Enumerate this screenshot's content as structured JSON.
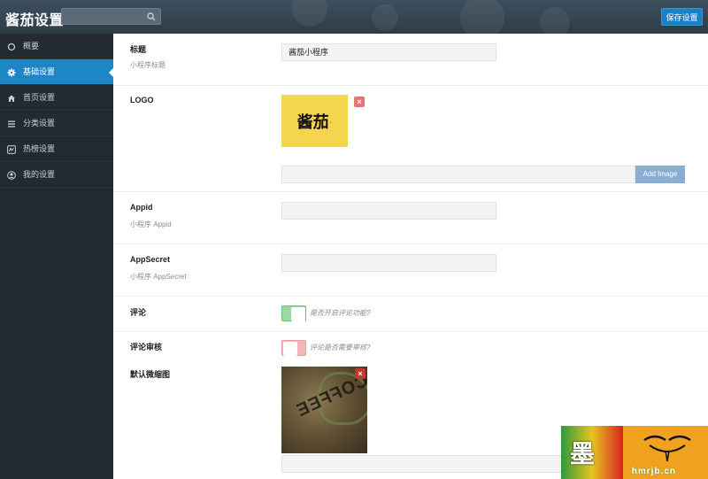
{
  "header": {
    "title": "酱茄设置",
    "search_placeholder": "",
    "save_label": "保存设置"
  },
  "sidebar": {
    "items": [
      {
        "label": "概要",
        "icon": "circle-icon"
      },
      {
        "label": "基础设置",
        "icon": "gear-icon",
        "active": true
      },
      {
        "label": "首页设置",
        "icon": "home-icon"
      },
      {
        "label": "分类设置",
        "icon": "list-icon"
      },
      {
        "label": "热榜设置",
        "icon": "chart-icon"
      },
      {
        "label": "我的设置",
        "icon": "user-circle-icon"
      }
    ]
  },
  "form": {
    "title": {
      "label": "标题",
      "sublabel": "小程序标题",
      "value": "酱茄小程序"
    },
    "logo": {
      "label": "LOGO",
      "logo_text": "酱茄",
      "logo_dot": ".",
      "add_image_label": "Add Image",
      "delete_icon": "×"
    },
    "appid": {
      "label": "Appid",
      "sublabel": "小程序 Appid",
      "value": ""
    },
    "appsecret": {
      "label": "AppSecret",
      "sublabel": "小程序 AppSecret",
      "value": ""
    },
    "comment": {
      "label": "评论",
      "hint": "是否开启评论功能?",
      "enabled": true
    },
    "comment_review": {
      "label": "评论审核",
      "hint": "评论是否需要审核?",
      "enabled": false
    },
    "default_thumb": {
      "label": "默认微缩图",
      "delete_icon": "×",
      "image_text": "COFFEE"
    }
  },
  "watermark": {
    "text": "hmrjb.cn"
  },
  "colors": {
    "accent": "#1c86c7",
    "sidebar_bg": "#232a31",
    "toggle_on": "#5cb85c",
    "toggle_off": "#e8a0a4",
    "delete": "#d9534f"
  }
}
